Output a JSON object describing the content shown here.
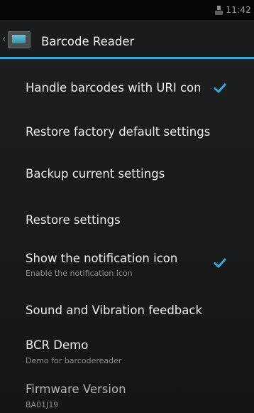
{
  "status_bar": {
    "time": "11:42",
    "icons": [
      "download-notification-icon"
    ]
  },
  "action_bar": {
    "title": "Barcode Reader",
    "up_indicator": "‹",
    "icon": "barcode-reader-app-icon",
    "accent_color": "#3aa9d4"
  },
  "preferences": [
    {
      "title": "Handle barcodes with URI cont",
      "summary": "",
      "checkbox": true,
      "checked": true
    },
    {
      "title": "Restore factory default settings",
      "summary": "",
      "checkbox": false
    },
    {
      "title": "Backup current settings",
      "summary": "",
      "checkbox": false
    },
    {
      "title": "Restore settings",
      "summary": "",
      "checkbox": false
    },
    {
      "title": "Show the notification icon",
      "summary": "Enable the notification icon",
      "checkbox": true,
      "checked": true
    },
    {
      "title": "Sound and Vibration feedback",
      "summary": "",
      "checkbox": false
    },
    {
      "title": "BCR Demo",
      "summary": "Demo for barcodereader",
      "checkbox": false
    },
    {
      "title": "Firmware Version",
      "summary": "BA01J19",
      "checkbox": false,
      "disabled": true
    }
  ],
  "colors": {
    "check_color": "#3aa9d4",
    "background": "#1b1c1e"
  }
}
